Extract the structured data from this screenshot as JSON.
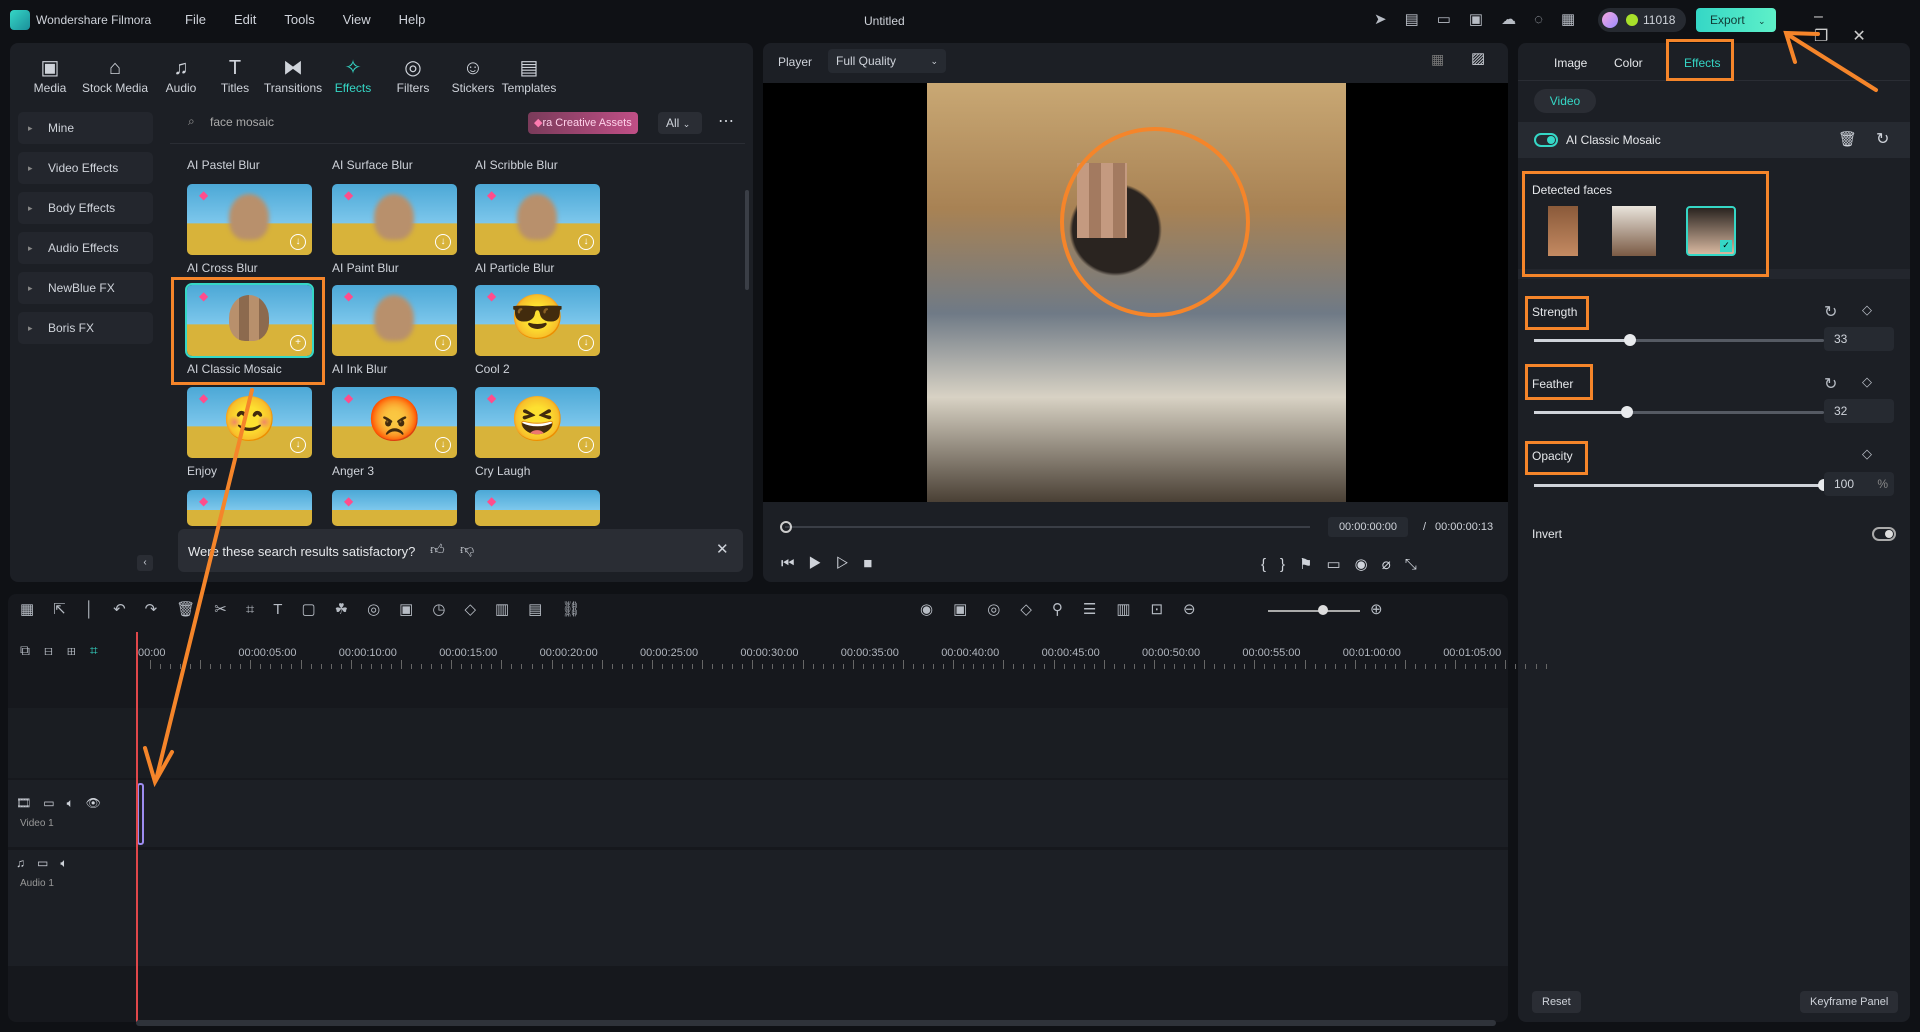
{
  "app": {
    "name": "Wondershare Filmora",
    "title": "Untitled",
    "menu": [
      "File",
      "Edit",
      "Tools",
      "View",
      "Help"
    ],
    "credits": "11018",
    "export": "Export"
  },
  "toolbar": [
    "Media",
    "Stock Media",
    "Audio",
    "Titles",
    "Transitions",
    "Effects",
    "Filters",
    "Stickers",
    "Templates"
  ],
  "toolbar_icons": [
    "▣",
    "⌂",
    "♫",
    "T",
    "⧓",
    "✧",
    "◎",
    "☺",
    "▤"
  ],
  "sidebar": [
    "Mine",
    "Video Effects",
    "Body Effects",
    "Audio Effects",
    "NewBlue FX",
    "Boris FX"
  ],
  "search": {
    "value": "face mosaic",
    "assets": "ra Creative Assets",
    "filter": "All"
  },
  "top_labels": [
    "AI Pastel Blur",
    "AI Surface Blur",
    "AI Scribble Blur"
  ],
  "effects": [
    {
      "label": "AI Cross Blur",
      "kind": "face"
    },
    {
      "label": "AI Paint Blur",
      "kind": "face"
    },
    {
      "label": "AI Particle Blur",
      "kind": "face"
    },
    {
      "label": "AI Classic Mosaic",
      "kind": "face"
    },
    {
      "label": "AI Ink Blur",
      "kind": "face"
    },
    {
      "label": "Cool 2",
      "kind": "emoji",
      "emoji": "😎"
    },
    {
      "label": "Enjoy",
      "kind": "emoji",
      "emoji": "😊"
    },
    {
      "label": "Anger 3",
      "kind": "emoji",
      "emoji": "😡"
    },
    {
      "label": "Cry Laugh",
      "kind": "emoji",
      "emoji": "😆"
    }
  ],
  "feedback": "Were these search results satisfactory?",
  "player": {
    "label": "Player",
    "quality": "Full Quality",
    "current": "00:00:00:00",
    "sep": "/",
    "total": "00:00:00:13"
  },
  "right": {
    "tabs": [
      "Image",
      "Color",
      "Effects"
    ],
    "active_tab": "Effects",
    "subtab": "Video",
    "effect_name": "AI Classic Mosaic",
    "detected_faces": "Detected faces",
    "strength": {
      "label": "Strength",
      "value": "33",
      "level": 33
    },
    "feather": {
      "label": "Feather",
      "value": "32",
      "level": 32
    },
    "opacity": {
      "label": "Opacity",
      "value": "100",
      "unit": "%",
      "level": 100
    },
    "invert": "Invert",
    "reset": "Reset",
    "keyframe": "Keyframe Panel"
  },
  "timeline": {
    "ticks": [
      "00:00",
      "00:00:05:00",
      "00:00:10:00",
      "00:00:15:00",
      "00:00:20:00",
      "00:00:25:00",
      "00:00:30:00",
      "00:00:35:00",
      "00:00:40:00",
      "00:00:45:00",
      "00:00:50:00",
      "00:00:55:00",
      "00:01:00:00",
      "00:01:05:00"
    ],
    "tracks": [
      {
        "label": "Video 1",
        "num": "1"
      },
      {
        "label": "Audio 1",
        "num": "1"
      }
    ]
  },
  "colors": {
    "accent": "#35d7c6",
    "annotation": "#f5852a",
    "bg": "#0f1115",
    "panel": "#1c1f25"
  }
}
